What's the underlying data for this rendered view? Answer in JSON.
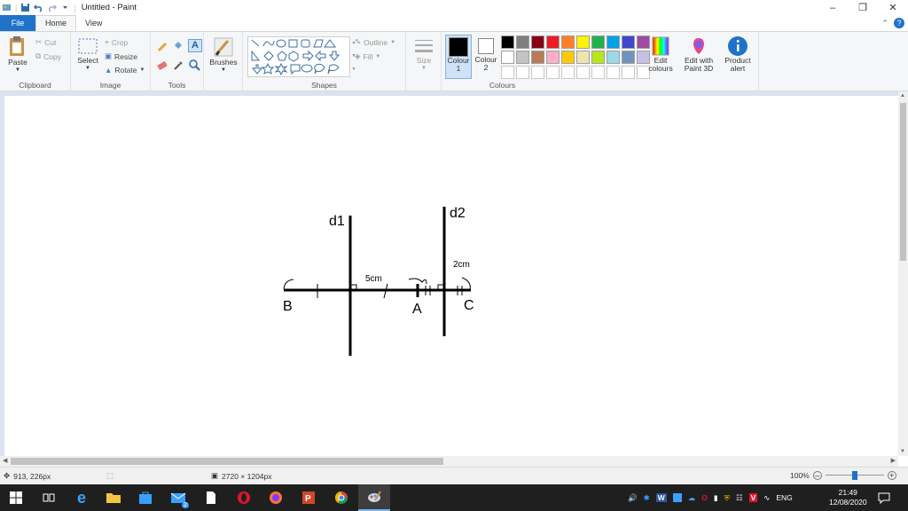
{
  "window": {
    "title": "Untitled - Paint"
  },
  "tabs": [
    {
      "label": "File"
    },
    {
      "label": "Home"
    },
    {
      "label": "View"
    }
  ],
  "clipboard": {
    "paste": "Paste",
    "cut": "Cut",
    "copy": "Copy",
    "group": "Clipboard"
  },
  "image": {
    "select": "Select",
    "crop": "Crop",
    "resize": "Resize",
    "rotate": "Rotate",
    "group": "Image"
  },
  "tools": {
    "group": "Tools"
  },
  "brushes": {
    "label": "Brushes"
  },
  "shapes": {
    "outline": "Outline",
    "fill": "Fill",
    "group": "Shapes"
  },
  "size": {
    "label": "Size"
  },
  "colours": {
    "colour1": "Colour 1",
    "colour2": "Colour 2",
    "edit": "Edit colours",
    "paint3d": "Edit with Paint 3D",
    "alert": "Product alert",
    "group": "Colours",
    "palette": [
      "#000000",
      "#7f7f7f",
      "#880015",
      "#ed1c24",
      "#ff7f27",
      "#fff200",
      "#22b14c",
      "#00a2e8",
      "#3f48cc",
      "#a349a4",
      "#ffffff",
      "#c3c3c3",
      "#b97a57",
      "#ffaec9",
      "#ffc90e",
      "#efe4b0",
      "#b5e61d",
      "#99d9ea",
      "#7092be",
      "#c8bfe7"
    ]
  },
  "drawing": {
    "d1": "d1",
    "d2": "d2",
    "five_cm": "5cm",
    "two_cm": "2cm",
    "point_a": "A",
    "point_b": "B",
    "point_c": "C"
  },
  "status": {
    "cursor": "913, 226px",
    "canvas_size": "2720 × 1204px",
    "zoom": "100%"
  },
  "tray": {
    "lang": "ENG",
    "time": "21:49",
    "date": "12/08/2020",
    "mail_badge": "2"
  }
}
